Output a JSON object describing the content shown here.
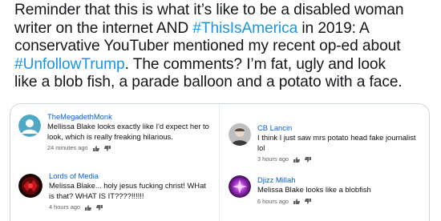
{
  "tweet": {
    "line1": "Reminder that this is what it’s like to be a disabled woman",
    "line2_a": "writer on the internet AND ",
    "line2_tag": "#ThisIsAmerica",
    "line2_b": " in 2019: A",
    "line3": "conservative YouTuber mentioned my recent op-ed about",
    "line4_tag": "#UnfollowTrump",
    "line4_b": ". The comments? I’m fat, ugly and look",
    "line5": "like a blob fish, a parade balloon and a potato with a face.",
    "hashtag_color": "#1b95e0"
  },
  "comments": [
    {
      "author": "TheMegadethMonk",
      "text": "Mellissa Blake looks exactly like I'd expect her to look, which is really freaking hilarious.",
      "time": "24 minutes ago",
      "avatar_icon": "default-person-avatar-icon"
    },
    {
      "author": "CB Lancin",
      "text": "I think I just saw mrs potato head fake journalist lol",
      "time": "3 hours ago",
      "avatar_icon": "photo-avatar-icon"
    },
    {
      "author": "Lords of Media",
      "text": "Melissa Blake... holy jesus fucking christ! WHat is that? WHAT IS IT????!!!!!!",
      "time": "4 hours ago",
      "avatar_icon": "red-graphic-avatar-icon"
    },
    {
      "author": "Djizz Millah",
      "text": "Melissa Blake looks like a blobfish",
      "time": "6 hours ago",
      "avatar_icon": "purple-glow-avatar-icon"
    }
  ],
  "colors": {
    "author_link": "#065fd4",
    "meta_gray": "#606060",
    "border": "#ccd6dd"
  }
}
